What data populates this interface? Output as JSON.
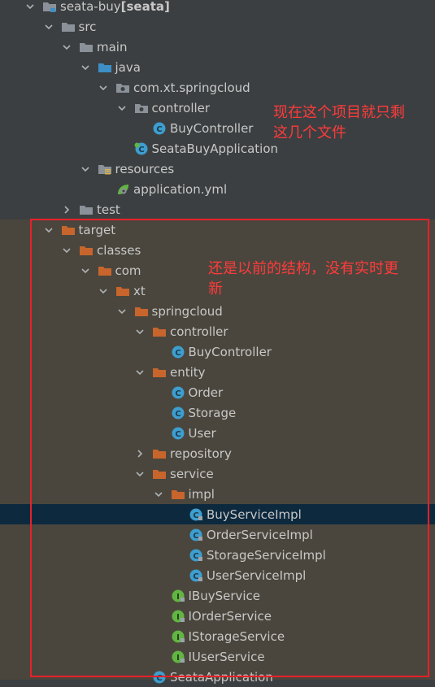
{
  "tree": [
    {
      "label": "seata-buy",
      "suffix": " [seata]",
      "icon": "module-folder-icon",
      "kind": "module",
      "depth": 0,
      "expanded": true
    },
    {
      "label": "src",
      "icon": "folder-icon",
      "kind": "gray",
      "depth": 1,
      "expanded": true
    },
    {
      "label": "main",
      "icon": "folder-icon",
      "kind": "gray",
      "depth": 2,
      "expanded": true
    },
    {
      "label": "java",
      "icon": "source-folder-icon",
      "kind": "blue",
      "depth": 3,
      "expanded": true
    },
    {
      "label": "com.xt.springcloud",
      "icon": "package-icon",
      "kind": "package",
      "depth": 4,
      "expanded": true
    },
    {
      "label": "controller",
      "icon": "package-icon",
      "kind": "package",
      "depth": 5,
      "expanded": true
    },
    {
      "label": "BuyController",
      "icon": "class-icon",
      "kind": "class",
      "depth": 6,
      "expanded": null
    },
    {
      "label": "SeataBuyApplication",
      "icon": "spring-boot-class-icon",
      "kind": "springclass",
      "depth": 5,
      "expanded": null
    },
    {
      "label": "resources",
      "icon": "resources-folder-icon",
      "kind": "resources",
      "depth": 3,
      "expanded": true
    },
    {
      "label": "application.yml",
      "icon": "yaml-file-icon",
      "kind": "yml",
      "depth": 4,
      "expanded": null
    },
    {
      "label": "test",
      "icon": "folder-icon",
      "kind": "gray",
      "depth": 2,
      "expanded": false
    },
    {
      "label": "target",
      "icon": "folder-icon",
      "kind": "orange",
      "depth": 1,
      "expanded": true
    },
    {
      "label": "classes",
      "icon": "folder-icon",
      "kind": "orange",
      "depth": 2,
      "expanded": true
    },
    {
      "label": "com",
      "icon": "folder-icon",
      "kind": "orange",
      "depth": 3,
      "expanded": true
    },
    {
      "label": "xt",
      "icon": "folder-icon",
      "kind": "orange",
      "depth": 4,
      "expanded": true
    },
    {
      "label": "springcloud",
      "icon": "folder-icon",
      "kind": "orange",
      "depth": 5,
      "expanded": true
    },
    {
      "label": "controller",
      "icon": "folder-icon",
      "kind": "orange",
      "depth": 6,
      "expanded": true
    },
    {
      "label": "BuyController",
      "icon": "class-icon",
      "kind": "class",
      "depth": 7,
      "expanded": null
    },
    {
      "label": "entity",
      "icon": "folder-icon",
      "kind": "orange",
      "depth": 6,
      "expanded": true
    },
    {
      "label": "Order",
      "icon": "class-icon",
      "kind": "class",
      "depth": 7,
      "expanded": null
    },
    {
      "label": "Storage",
      "icon": "class-icon",
      "kind": "class",
      "depth": 7,
      "expanded": null
    },
    {
      "label": "User",
      "icon": "class-icon",
      "kind": "class",
      "depth": 7,
      "expanded": null
    },
    {
      "label": "repository",
      "icon": "folder-icon",
      "kind": "orange",
      "depth": 6,
      "expanded": false
    },
    {
      "label": "service",
      "icon": "folder-icon",
      "kind": "orange",
      "depth": 6,
      "expanded": true
    },
    {
      "label": "impl",
      "icon": "folder-icon",
      "kind": "orange",
      "depth": 7,
      "expanded": true
    },
    {
      "label": "BuyServiceImpl",
      "icon": "compiled-class-icon",
      "kind": "cclass",
      "depth": 8,
      "expanded": null,
      "selected": true
    },
    {
      "label": "OrderServiceImpl",
      "icon": "compiled-class-icon",
      "kind": "cclass",
      "depth": 8,
      "expanded": null
    },
    {
      "label": "StorageServiceImpl",
      "icon": "compiled-class-icon",
      "kind": "cclass",
      "depth": 8,
      "expanded": null
    },
    {
      "label": "UserServiceImpl",
      "icon": "compiled-class-icon",
      "kind": "cclass",
      "depth": 8,
      "expanded": null
    },
    {
      "label": "IBuyService",
      "icon": "interface-icon",
      "kind": "iface",
      "depth": 7,
      "expanded": null
    },
    {
      "label": "IOrderService",
      "icon": "interface-icon",
      "kind": "iface",
      "depth": 7,
      "expanded": null
    },
    {
      "label": "IStorageService",
      "icon": "interface-icon",
      "kind": "iface",
      "depth": 7,
      "expanded": null
    },
    {
      "label": "IUserService",
      "icon": "interface-icon",
      "kind": "iface",
      "depth": 7,
      "expanded": null
    },
    {
      "label": "SeataApplication",
      "icon": "class-icon",
      "kind": "class",
      "depth": 6,
      "expanded": null
    }
  ],
  "annotations": {
    "top_line1": "现在这个项目就只剩",
    "top_line2": "这几个文件",
    "bottom_line1": "还是以前的结构，没有实时更",
    "bottom_line2": "新"
  },
  "colors": {
    "annotation": "#ff3b3b",
    "highlight_box": "#e8202a",
    "selected_row": "#0d293e",
    "folder_orange": "#c8652c",
    "folder_gray": "#8a9199",
    "folder_blue": "#3d8fc6",
    "class_blue": "#3d9ecf",
    "interface_green": "#62b543"
  }
}
